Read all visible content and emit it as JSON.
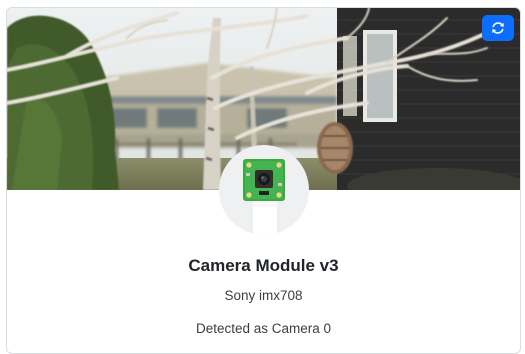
{
  "card": {
    "title": "Camera Module v3",
    "sensor": "Sony imx708",
    "status": "Detected as Camera 0"
  },
  "actions": {
    "refresh_icon": "refresh-icon"
  },
  "colors": {
    "accent": "#0d6efd"
  }
}
